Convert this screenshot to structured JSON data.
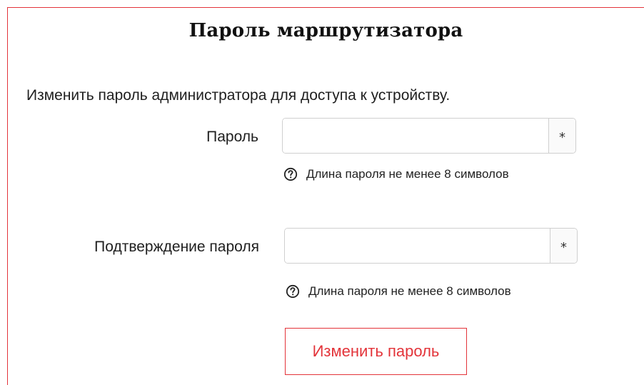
{
  "page": {
    "title": "Пароль маршрутизатора",
    "description": "Изменить пароль администратора для доступа к устройству."
  },
  "form": {
    "password": {
      "label": "Пароль",
      "value": "",
      "placeholder": "",
      "addon": "*",
      "hint": "Длина пароля не менее 8 символов"
    },
    "confirm": {
      "label": "Подтверждение пароля",
      "value": "",
      "placeholder": "",
      "addon": "*",
      "hint": "Длина пароля не менее 8 символов"
    },
    "submit_label": "Изменить пароль"
  },
  "colors": {
    "accent": "#e3343a",
    "border": "#cfcfcf",
    "text": "#1f1f1f"
  },
  "icons": {
    "hint_icon": "question-circle-icon",
    "addon_icon": "asterisk-icon"
  }
}
